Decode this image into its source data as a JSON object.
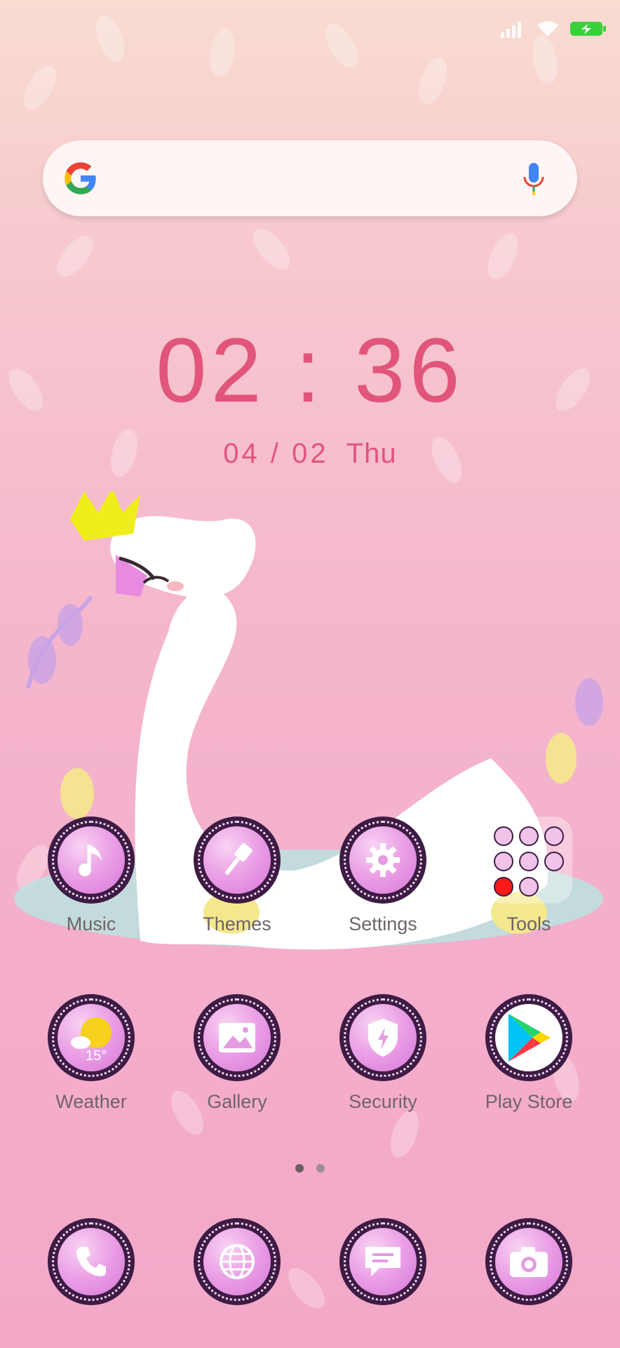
{
  "status_bar": {
    "signal_icon": "signal-icon",
    "wifi_icon": "wifi-icon",
    "battery_icon": "battery-charging-icon",
    "battery_color": "#39d13a"
  },
  "search": {
    "logo_icon": "google-g-icon",
    "mic_icon": "microphone-icon"
  },
  "clock": {
    "time": "02 : 36",
    "date_day": "04 / 02",
    "weekday": "Thu"
  },
  "apps_row1": [
    {
      "label": "Music",
      "icon": "music-note-icon"
    },
    {
      "label": "Themes",
      "icon": "paintbrush-icon"
    },
    {
      "label": "Settings",
      "icon": "gear-icon"
    },
    {
      "label": "Tools",
      "icon": "folder-icon"
    }
  ],
  "apps_row2": [
    {
      "label": "Weather",
      "icon": "weather-sun-icon",
      "temperature": "15°"
    },
    {
      "label": "Gallery",
      "icon": "image-icon"
    },
    {
      "label": "Security",
      "icon": "shield-icon"
    },
    {
      "label": "Play Store",
      "icon": "play-store-icon"
    }
  ],
  "dock": [
    {
      "icon": "phone-icon"
    },
    {
      "icon": "globe-icon"
    },
    {
      "icon": "message-icon"
    },
    {
      "icon": "camera-icon"
    }
  ],
  "page_indicator": {
    "pages": 2,
    "active": 1
  },
  "colors": {
    "accent": "#e2557a",
    "icon_ring": "#3d1c44",
    "icon_fill": "#eba2e6",
    "label_text": "#6f6466"
  }
}
